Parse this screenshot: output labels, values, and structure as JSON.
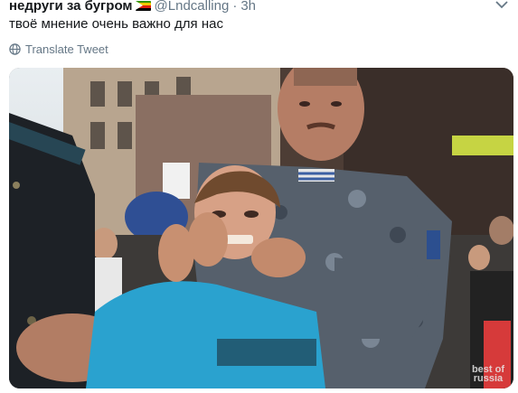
{
  "tweet": {
    "author_name": "недруги за бугром",
    "handle": "@Lndcalling",
    "separator": "·",
    "time": "3h",
    "text": "твоё мнение очень важно для нас",
    "translate_label": "Translate Tweet",
    "media": {
      "watermark_line1": "best of",
      "watermark_line2": "russia"
    }
  },
  "colors": {
    "secondary_text": "#657786",
    "primary_text": "#14171a"
  },
  "icons": {
    "flag": "zimbabwe-flag-icon",
    "caret": "chevron-down-icon",
    "translate": "globe-icon"
  }
}
